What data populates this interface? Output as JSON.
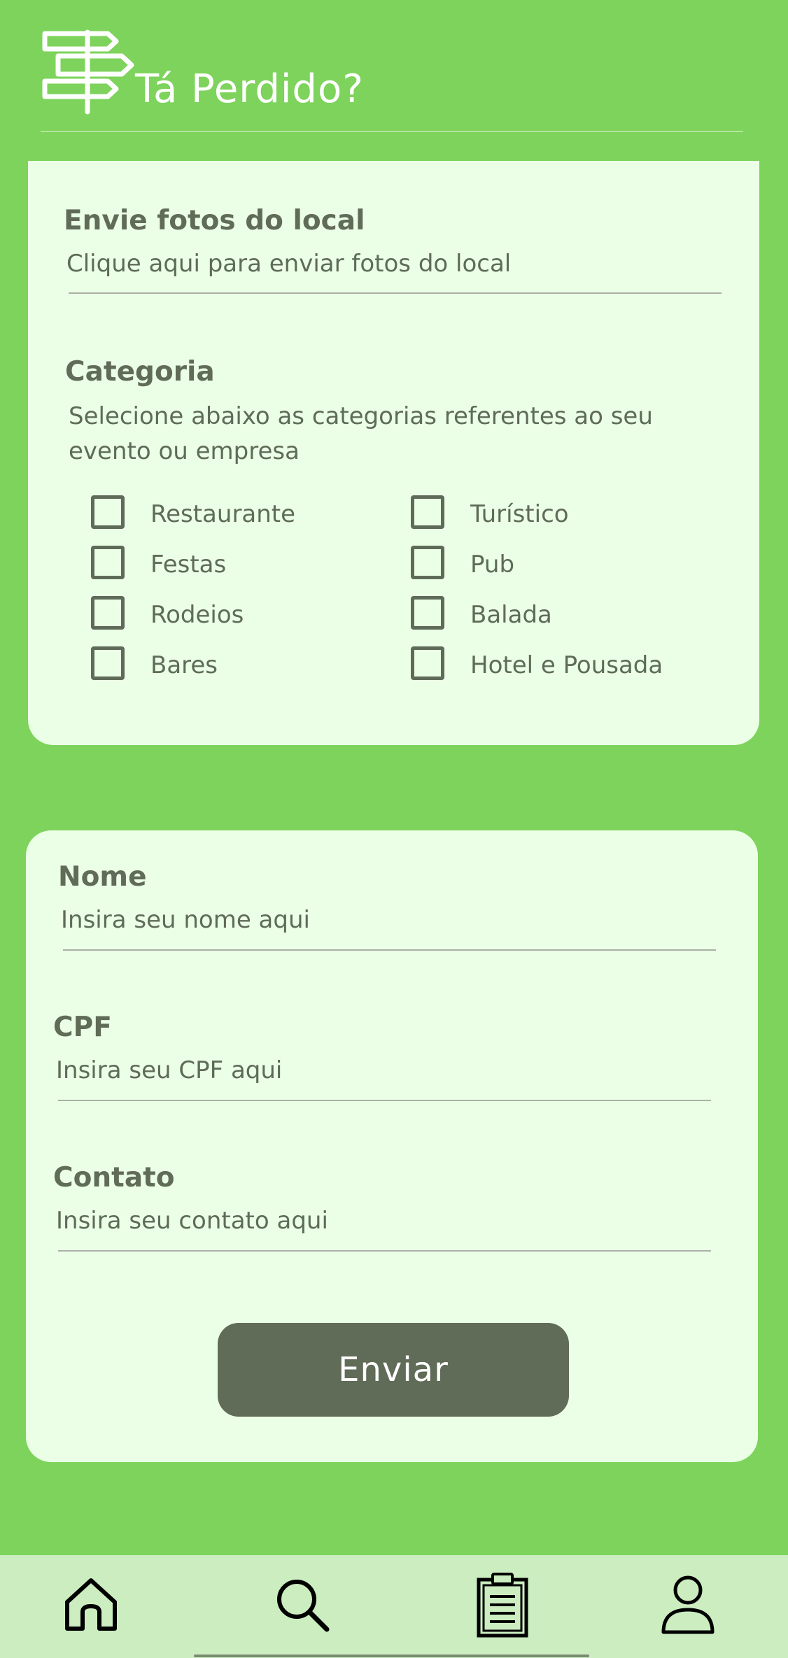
{
  "app": {
    "title": "Tá Perdido?"
  },
  "photos": {
    "label": "Envie fotos do local",
    "placeholder": "Clique aqui para enviar fotos do local"
  },
  "category": {
    "label": "Categoria",
    "description": "Selecione abaixo as categorias referentes ao seu evento ou empresa",
    "options_left": [
      "Restaurante",
      "Festas",
      "Rodeios",
      "Bares"
    ],
    "options_right": [
      "Turístico",
      "Pub",
      "Balada",
      "Hotel e Pousada"
    ],
    "checked": []
  },
  "form": {
    "name_label": "Nome",
    "name_placeholder": "Insira seu nome aqui",
    "cpf_label": "CPF",
    "cpf_placeholder": "Insira seu CPF aqui",
    "contact_label": "Contato",
    "contact_placeholder": "Insira seu contato aqui",
    "submit_label": "Enviar"
  },
  "nav": {
    "items": [
      {
        "icon": "home-icon"
      },
      {
        "icon": "search-icon"
      },
      {
        "icon": "clipboard-icon"
      },
      {
        "icon": "profile-icon"
      }
    ]
  },
  "colors": {
    "background": "#7dd35b",
    "card": "#ebffe6",
    "text": "#5f6b59",
    "button": "#606b58",
    "nav_bar": "#cbedc0"
  }
}
